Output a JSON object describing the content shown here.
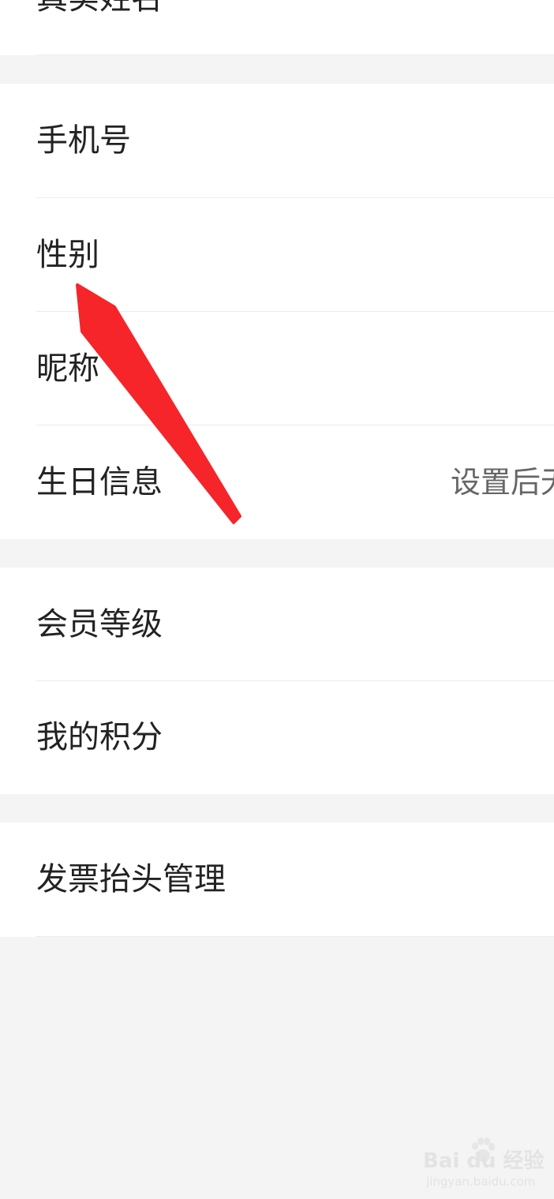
{
  "groups": [
    {
      "rows": [
        {
          "label": "真实姓名"
        }
      ]
    },
    {
      "rows": [
        {
          "label": "手机号"
        },
        {
          "label": "性别"
        },
        {
          "label": "昵称"
        },
        {
          "label": "生日信息",
          "value": "设置后无"
        }
      ]
    },
    {
      "rows": [
        {
          "label": "会员等级"
        },
        {
          "label": "我的积分"
        }
      ]
    },
    {
      "rows": [
        {
          "label": "发票抬头管理"
        }
      ]
    }
  ],
  "annotation": {
    "arrow_color": "#f5252a"
  },
  "watermark": {
    "main": "Bai du 经验",
    "sub": "jingyan.baidu.com"
  }
}
